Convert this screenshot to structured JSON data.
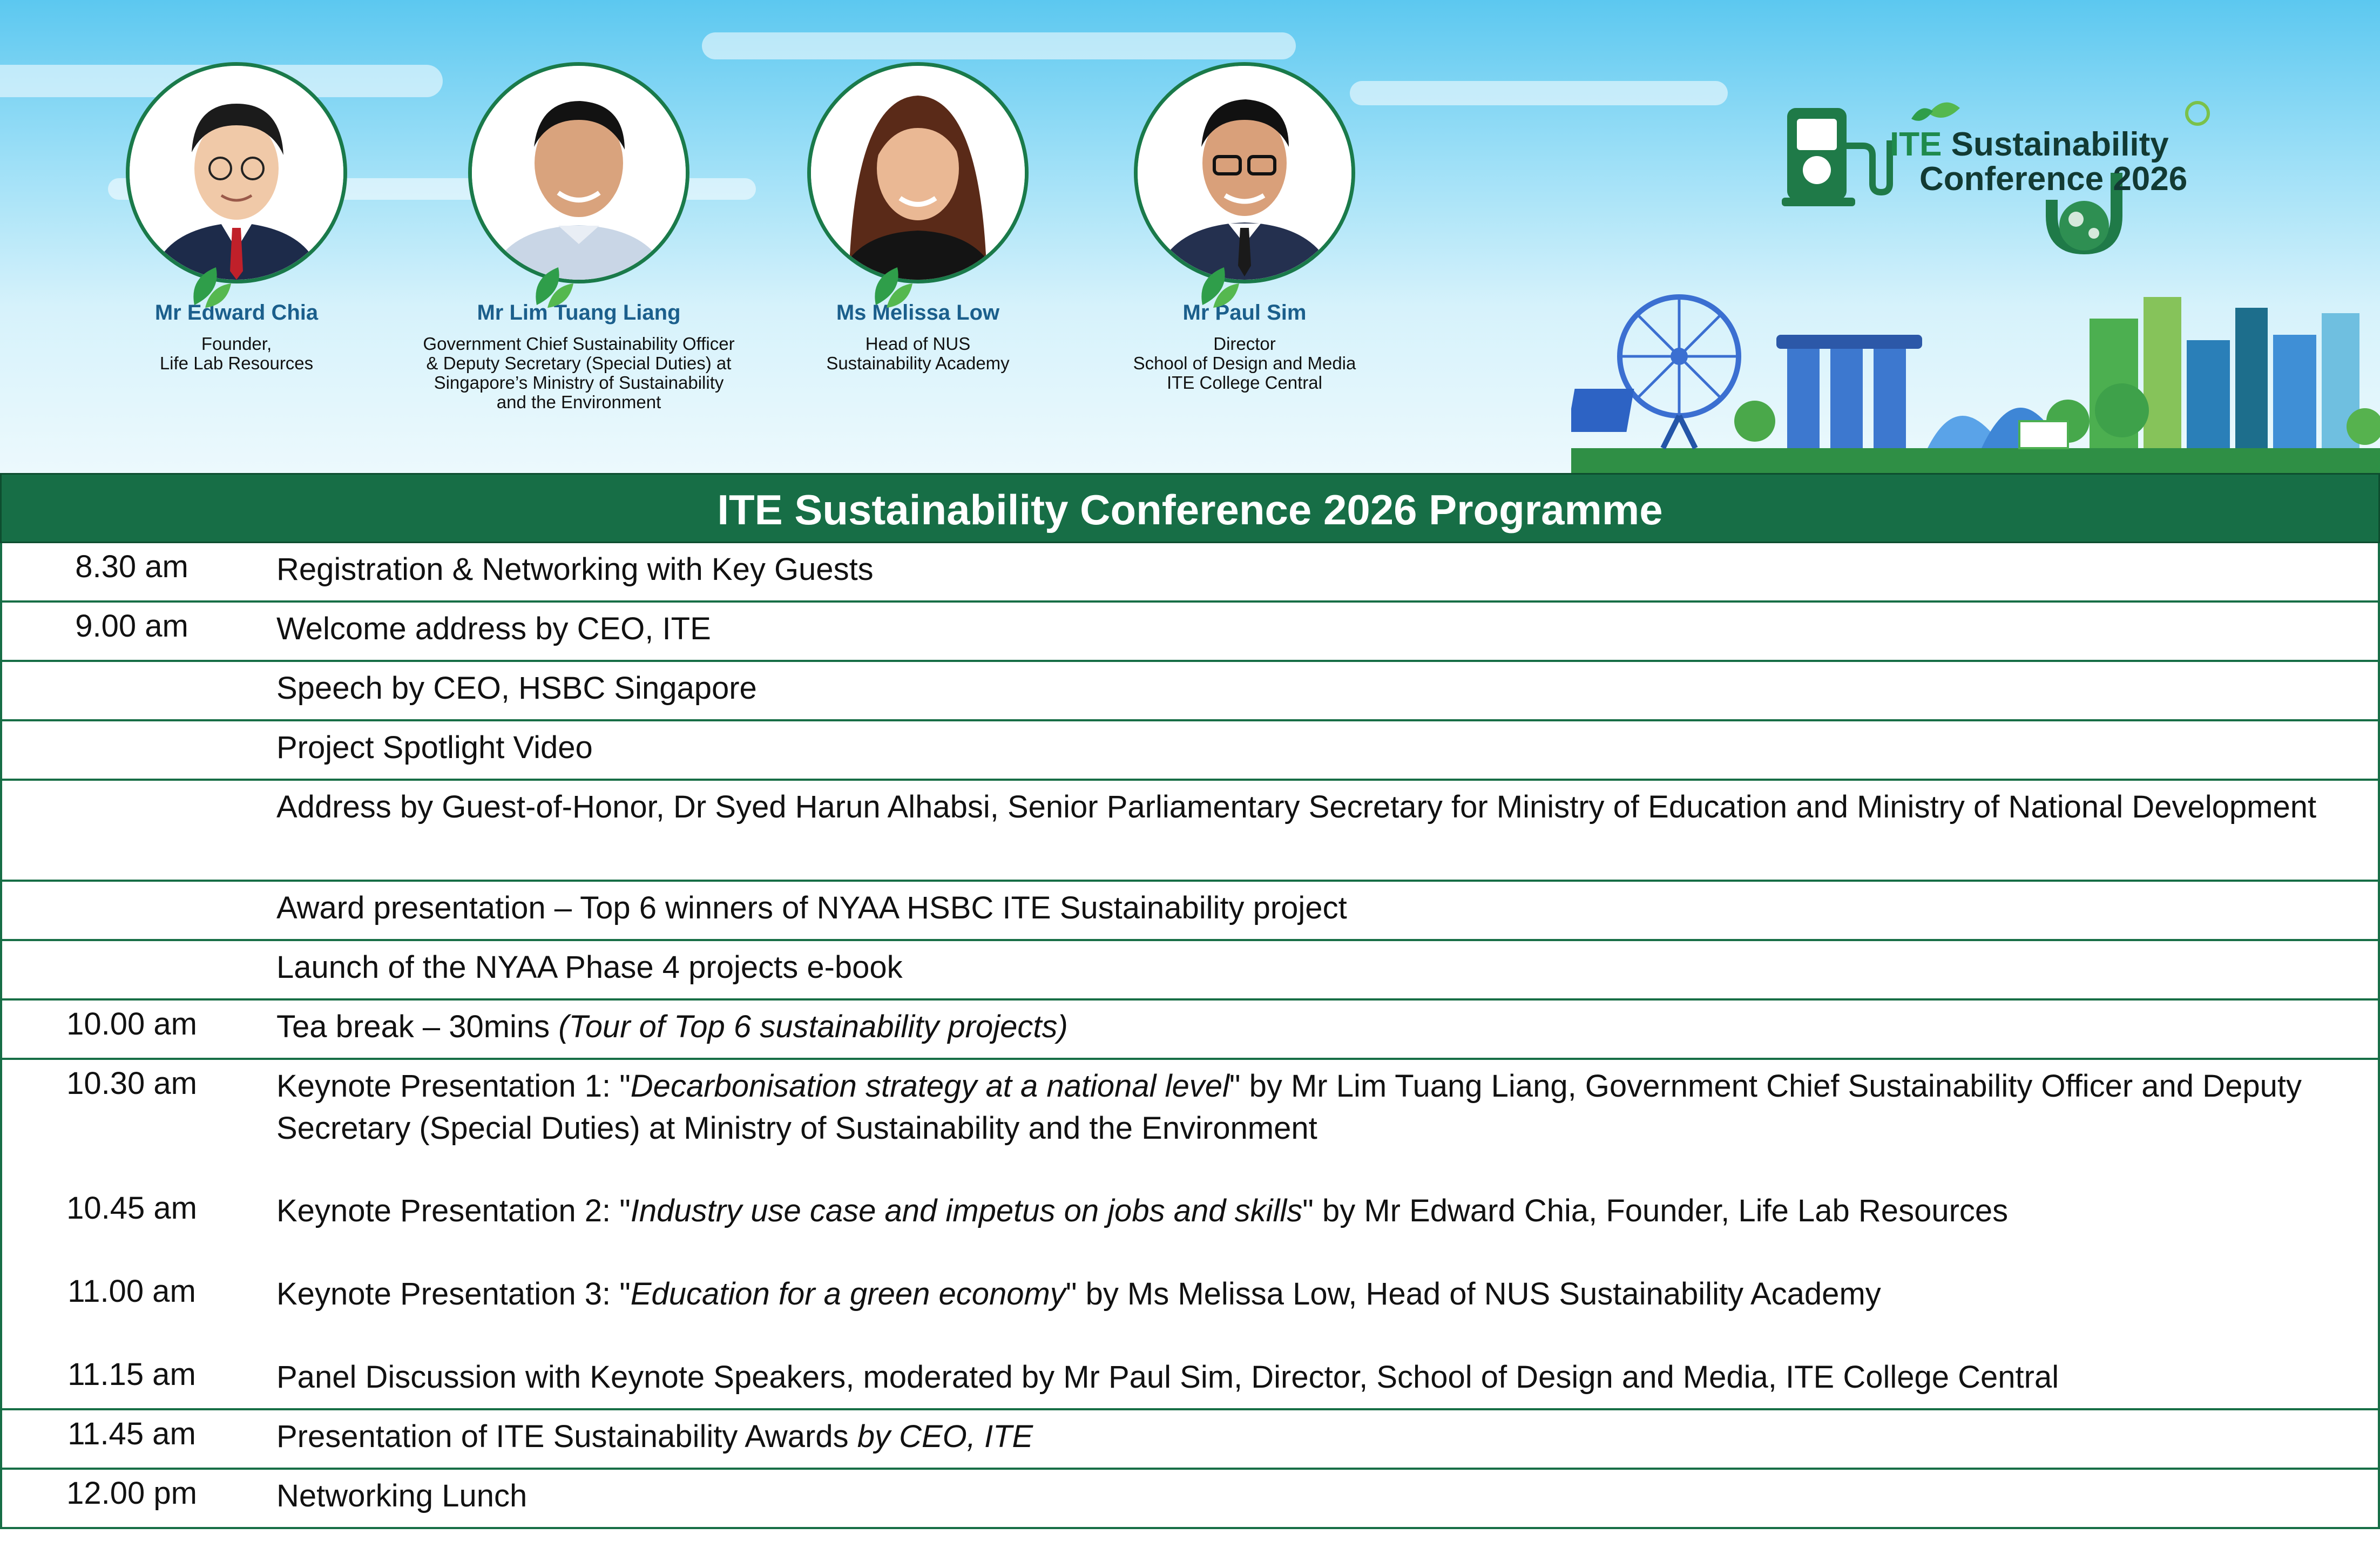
{
  "speakers": [
    {
      "name": "Mr Edward Chia",
      "role": "Founder,\nLife Lab Resources"
    },
    {
      "name": "Mr Lim Tuang Liang",
      "role": "Government Chief Sustainability Officer\n& Deputy Secretary (Special Duties) at\nSingapore’s Ministry of Sustainability\nand the Environment"
    },
    {
      "name": "Ms Melissa Low",
      "role": "Head of NUS\nSustainability Academy"
    },
    {
      "name": "Mr Paul Sim",
      "role": "Director\nSchool of Design and Media\nITE College Central"
    }
  ],
  "logo": {
    "prefix": "ITE",
    "line1_rest": " Sustainability",
    "line2": "Conference 2026"
  },
  "programme": {
    "title": "ITE Sustainability Conference 2026 Programme",
    "rows": [
      {
        "time": "8.30 am",
        "parts": [
          "Registration & Networking with Key Guests"
        ]
      },
      {
        "time": "9.00 am",
        "parts": [
          "Welcome address by CEO, ITE"
        ]
      },
      {
        "time": "",
        "parts": [
          "Speech by CEO, HSBC Singapore"
        ]
      },
      {
        "time": "",
        "parts": [
          "Project Spotlight Video"
        ]
      },
      {
        "time": "",
        "parts": [
          "Address by Guest-of-Honor, Dr Syed Harun Alhabsi, Senior Parliamentary Secretary for Ministry of Education and Ministry of National Development"
        ]
      },
      {
        "time": "",
        "parts": [
          "Award presentation –  Top 6 winners of NYAA HSBC ITE Sustainability project"
        ]
      },
      {
        "time": "",
        "parts": [
          "Launch of the NYAA Phase 4 projects e-book"
        ]
      },
      {
        "time": "10.00 am",
        "parts": [
          "Tea break – 30mins ",
          "(Tour of Top 6 sustainability projects)"
        ]
      },
      {
        "time": "10.30 am",
        "parts": [
          "Keynote Presentation 1: \"",
          "Decarbonisation strategy at a national level",
          "\" by Mr Lim Tuang Liang, Government Chief Sustainability Officer and Deputy Secretary (Special Duties) at Ministry of Sustainability and the Environment"
        ]
      },
      {
        "time": "10.45 am",
        "parts": [
          "Keynote Presentation 2: \"",
          "Industry use case and impetus on jobs and skills",
          "\" by Mr Edward Chia, Founder, Life Lab Resources"
        ]
      },
      {
        "time": "11.00 am",
        "parts": [
          "Keynote Presentation 3: \"",
          "Education for a green economy",
          "\" by Ms Melissa Low, Head of NUS Sustainability Academy"
        ]
      },
      {
        "time": "11.15 am",
        "parts": [
          "Panel Discussion with Keynote Speakers, moderated by Mr Paul Sim, Director, School of Design and Media, ITE College Central"
        ]
      },
      {
        "time": "11.45 am",
        "parts": [
          "Presentation of ITE Sustainability Awards ",
          "by CEO, ITE"
        ]
      },
      {
        "time": "12.00 pm",
        "parts": [
          "Networking Lunch"
        ]
      }
    ]
  },
  "colors": {
    "green": "#176e46",
    "name_blue": "#1b5f8c",
    "sky": "#9fe0f7"
  }
}
